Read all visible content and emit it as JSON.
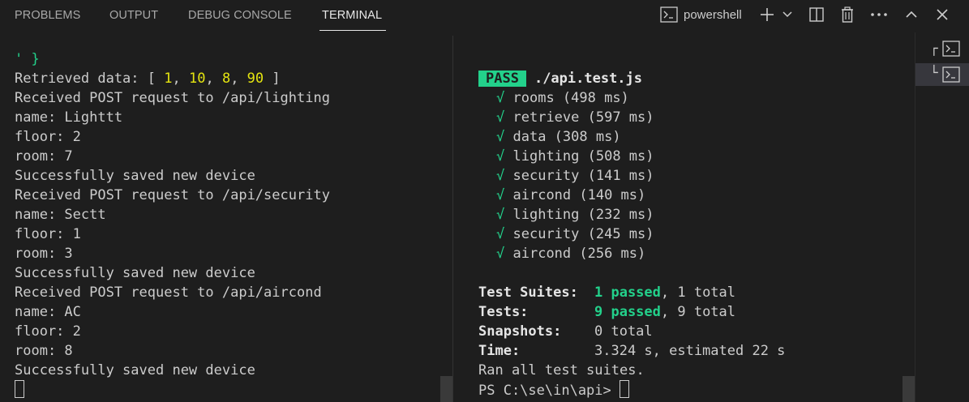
{
  "tabs": [
    {
      "label": "PROBLEMS"
    },
    {
      "label": "OUTPUT"
    },
    {
      "label": "DEBUG CONSOLE"
    },
    {
      "label": "TERMINAL"
    }
  ],
  "terminal_profile": {
    "label": "powershell"
  },
  "left_terminal": {
    "quote_close": "' }",
    "retrieved_prefix": "Retrieved data: [ ",
    "retrieved_values": [
      "1",
      "10",
      "8",
      "90"
    ],
    "retrieved_suffix": " ]",
    "lines": [
      "Received POST request to /api/lighting",
      "name: Lighttt",
      "floor: 2",
      "room: 7",
      "Successfully saved new device",
      "Received POST request to /api/security",
      "name: Sectt",
      "floor: 1",
      "room: 3",
      "Successfully saved new device",
      "Received POST request to /api/aircond",
      "name: AC",
      "floor: 2",
      "room: 8",
      "Successfully saved new device"
    ]
  },
  "right_terminal": {
    "pass_badge": "PASS",
    "test_file": "./api.test.js",
    "check_mark": "√",
    "tests": [
      "rooms (498 ms)",
      "retrieve (597 ms)",
      "data (308 ms)",
      "lighting (508 ms)",
      "security (141 ms)",
      "aircond (140 ms)",
      "lighting (232 ms)",
      "security (245 ms)",
      "aircond (256 ms)"
    ],
    "summary": {
      "suites_label": "Test Suites:",
      "suites_passed": "1 passed",
      "suites_rest": ", 1 total",
      "tests_label": "Tests:",
      "tests_passed": "9 passed",
      "tests_rest": ", 9 total",
      "snapshots_label": "Snapshots:",
      "snapshots_value": "0 total",
      "time_label": "Time:",
      "time_value": "3.324 s, estimated 22 s",
      "ran_all": "Ran all test suites.",
      "prompt": "PS C:\\se\\in\\api> "
    }
  }
}
